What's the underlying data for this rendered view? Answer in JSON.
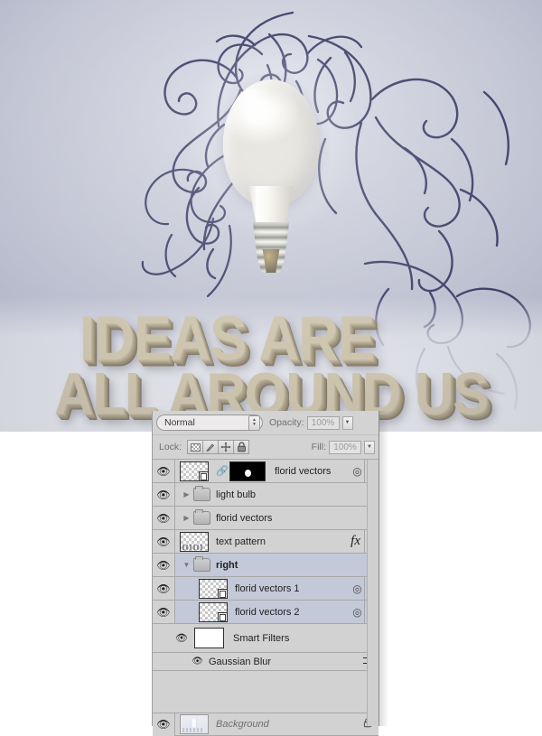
{
  "artwork": {
    "headline_line1": "IDEAS ARE",
    "headline_line2": "ALL AROUND US",
    "bulb_icon": "light-bulb",
    "ornament_icon": "florid-swirl-ornament",
    "colors": {
      "background_top": "#b7bac9",
      "background_bottom": "#e9e9ef",
      "ornament_stroke": "#3d3f68",
      "text_face": "#cdc4ae",
      "text_extrude": "#837a67"
    }
  },
  "panel": {
    "blend": {
      "mode_value": "Normal",
      "spinner_icon": "stepper-up-down-icon",
      "opacity_label": "Opacity:",
      "opacity_value": "100%",
      "opacity_arrow_icon": "chevron-down-icon"
    },
    "lock": {
      "label": "Lock:",
      "buttons": [
        {
          "name": "lock-transparent-pixels",
          "icon": "checkerboard-icon"
        },
        {
          "name": "lock-image-pixels",
          "icon": "brush-icon",
          "glyph": "✐"
        },
        {
          "name": "lock-position",
          "icon": "move-cross-icon",
          "glyph": "✤"
        },
        {
          "name": "lock-all",
          "icon": "padlock-icon",
          "glyph": "ὑ2"
        }
      ],
      "fill_label": "Fill:",
      "fill_value": "100%",
      "fill_arrow_icon": "chevron-down-icon"
    },
    "layers": [
      {
        "id": "florid-vectors-masked",
        "name": "florid vectors",
        "kind": "smart-object-with-mask",
        "visible": true,
        "selected": false,
        "indent": 0,
        "has_chain_link": true,
        "has_mask": true,
        "right_badge_icon": "smart-object-badge-icon",
        "disclosure_icon": "chevron-down-icon",
        "bold": false
      },
      {
        "id": "light-bulb-group",
        "name": "light bulb",
        "kind": "group",
        "visible": true,
        "selected": false,
        "indent": 0,
        "expanded": false,
        "triangle_icon": "triangle-right-icon",
        "folder_icon": "folder-icon",
        "bold": false
      },
      {
        "id": "florid-vectors-group",
        "name": "florid vectors",
        "kind": "group",
        "visible": true,
        "selected": false,
        "indent": 0,
        "expanded": false,
        "triangle_icon": "triangle-right-icon",
        "folder_icon": "folder-icon",
        "bold": false
      },
      {
        "id": "text-pattern",
        "name": "text pattern",
        "kind": "raster",
        "visible": true,
        "selected": false,
        "indent": 0,
        "fx_label": "fx",
        "fx_icon": "layer-effects-fx-icon",
        "disclosure_icon": "chevron-down-icon",
        "bold": false
      },
      {
        "id": "right-group",
        "name": "right",
        "kind": "group",
        "visible": true,
        "selected": true,
        "indent": 0,
        "expanded": true,
        "triangle_icon": "triangle-down-icon",
        "folder_icon": "folder-icon",
        "bold": true
      },
      {
        "id": "florid-vectors-1",
        "name": "florid vectors 1",
        "kind": "smart-object",
        "visible": true,
        "selected": true,
        "indent": 1,
        "right_badge_icon": "smart-object-badge-icon",
        "disclosure_icon": "chevron-down-icon",
        "bold": false
      },
      {
        "id": "florid-vectors-2",
        "name": "florid vectors 2",
        "kind": "smart-object",
        "visible": true,
        "selected": true,
        "indent": 1,
        "right_badge_icon": "smart-object-badge-icon",
        "disclosure_icon": "chevron-up-icon",
        "bold": false
      }
    ],
    "smart_filters": {
      "label": "Smart Filters",
      "visible": true,
      "eye_icon": "eye-icon",
      "thumb": "white-mask-thumbnail",
      "filters": [
        {
          "name": "Gaussian Blur",
          "visible": true,
          "eye_icon": "eye-icon",
          "options_icon": "filter-blending-options-icon"
        }
      ]
    },
    "background_layer": {
      "name": "Background",
      "visible": true,
      "locked": true,
      "lock_icon": "padlock-icon",
      "eye_icon": "eye-icon"
    },
    "scrollbar_icon": "vertical-scrollbar"
  }
}
